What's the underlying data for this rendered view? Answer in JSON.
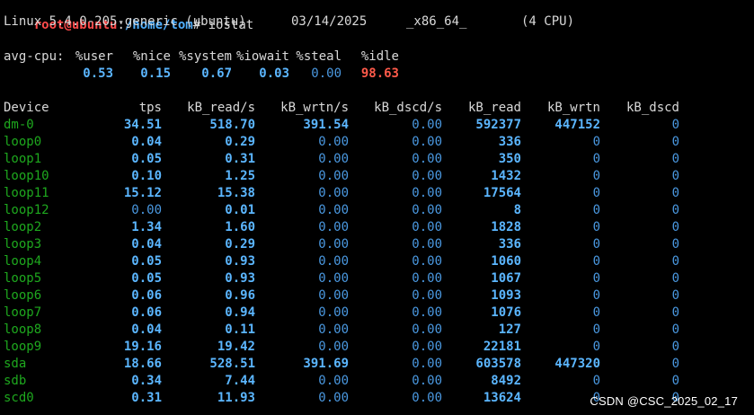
{
  "prompt": {
    "user_host": "root@ubuntu",
    "colon": ":",
    "path": "/home/tom",
    "symbol": "#",
    "command": "iostat"
  },
  "sysinfo": {
    "kernel": "Linux 5.4.0-205-generic (ubuntu)",
    "date": "03/14/2025",
    "arch": "_x86_64_",
    "cpus": "(4 CPU)"
  },
  "avg_cpu": {
    "label": "avg-cpu:",
    "headers": [
      "%user",
      "%nice",
      "%system",
      "%iowait",
      "%steal",
      "%idle"
    ],
    "values": [
      "0.53",
      "0.15",
      "0.67",
      "0.03",
      "0.00",
      "98.63"
    ]
  },
  "device_table": {
    "headers": [
      "Device",
      "tps",
      "kB_read/s",
      "kB_wrtn/s",
      "kB_dscd/s",
      "kB_read",
      "kB_wrtn",
      "kB_dscd"
    ],
    "rows": [
      [
        "dm-0",
        "34.51",
        "518.70",
        "391.54",
        "0.00",
        "592377",
        "447152",
        "0"
      ],
      [
        "loop0",
        "0.04",
        "0.29",
        "0.00",
        "0.00",
        "336",
        "0",
        "0"
      ],
      [
        "loop1",
        "0.05",
        "0.31",
        "0.00",
        "0.00",
        "350",
        "0",
        "0"
      ],
      [
        "loop10",
        "0.10",
        "1.25",
        "0.00",
        "0.00",
        "1432",
        "0",
        "0"
      ],
      [
        "loop11",
        "15.12",
        "15.38",
        "0.00",
        "0.00",
        "17564",
        "0",
        "0"
      ],
      [
        "loop12",
        "0.00",
        "0.01",
        "0.00",
        "0.00",
        "8",
        "0",
        "0"
      ],
      [
        "loop2",
        "1.34",
        "1.60",
        "0.00",
        "0.00",
        "1828",
        "0",
        "0"
      ],
      [
        "loop3",
        "0.04",
        "0.29",
        "0.00",
        "0.00",
        "336",
        "0",
        "0"
      ],
      [
        "loop4",
        "0.05",
        "0.93",
        "0.00",
        "0.00",
        "1060",
        "0",
        "0"
      ],
      [
        "loop5",
        "0.05",
        "0.93",
        "0.00",
        "0.00",
        "1067",
        "0",
        "0"
      ],
      [
        "loop6",
        "0.06",
        "0.96",
        "0.00",
        "0.00",
        "1093",
        "0",
        "0"
      ],
      [
        "loop7",
        "0.06",
        "0.94",
        "0.00",
        "0.00",
        "1076",
        "0",
        "0"
      ],
      [
        "loop8",
        "0.04",
        "0.11",
        "0.00",
        "0.00",
        "127",
        "0",
        "0"
      ],
      [
        "loop9",
        "19.16",
        "19.42",
        "0.00",
        "0.00",
        "22181",
        "0",
        "0"
      ],
      [
        "sda",
        "18.66",
        "528.51",
        "391.69",
        "0.00",
        "603578",
        "447320",
        "0"
      ],
      [
        "sdb",
        "0.34",
        "7.44",
        "0.00",
        "0.00",
        "8492",
        "0",
        "0"
      ],
      [
        "scd0",
        "0.31",
        "11.93",
        "0.00",
        "0.00",
        "13624",
        "0",
        "0"
      ]
    ]
  },
  "watermark": "CSDN @CSC_2025_02_17",
  "colors": {
    "background": "#000000",
    "text": "#d9d9d9",
    "prompt_user": "#ff4b4b",
    "prompt_path": "#4fb0ff",
    "number_bold": "#5bb6ff",
    "number_dim": "#4a98e0",
    "idle": "#ff5a4a",
    "device": "#1ea81e"
  }
}
